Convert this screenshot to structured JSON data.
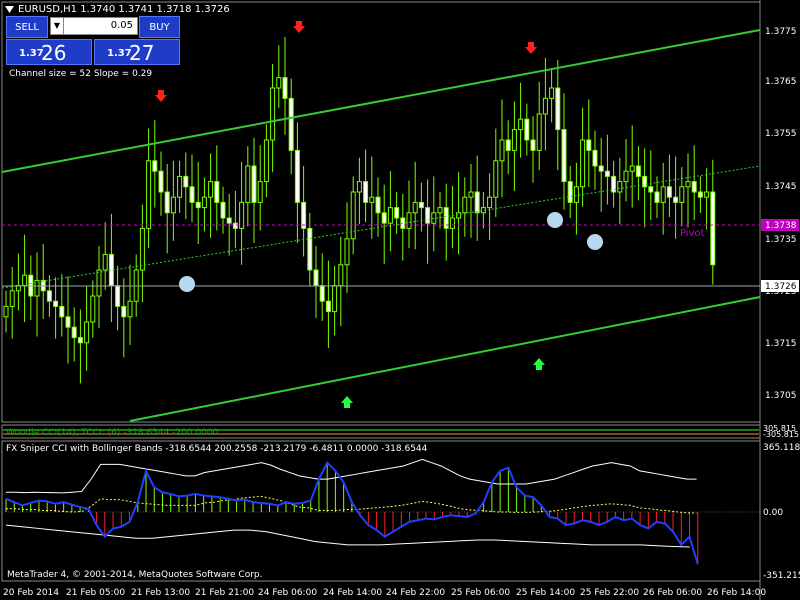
{
  "window_title": "EURUSD,H1  1.3740 1.3741 1.3718 1.3726",
  "trade_panel": {
    "sell_label": "SELL",
    "buy_label": "BUY",
    "lot_value": "0.05",
    "bid_small": "1.37",
    "bid_big": "26",
    "ask_small": "1.37",
    "ask_big": "27"
  },
  "channel_info": "Channel size = 52 Slope = 0.29",
  "pivot_label": "Pivot",
  "price_scale": [
    "1.3775",
    "1.3765",
    "1.3755",
    "1.3745",
    "1.3735",
    "1.3725",
    "1.3715",
    "1.3705"
  ],
  "price_tags": {
    "pivot": "1.3738",
    "current": "1.3726"
  },
  "indicator1": {
    "label": "Woodie CCI(14), TCCI: (6) -318.6544 -200.0000",
    "scale_top": "305.815",
    "scale_bottom": "-305.815"
  },
  "indicator2": {
    "label": "FX Sniper CCI with Bollinger Bands -318.6544 200.2558 -213.2179 -6.4811 0.0000 -318.6544",
    "scale": [
      "365.1188",
      "0.00",
      "-351.2151"
    ]
  },
  "time_axis": [
    "20 Feb 2014",
    "21 Feb 05:00",
    "21 Feb 13:00",
    "21 Feb 21:00",
    "24 Feb 06:00",
    "24 Feb 14:00",
    "24 Feb 22:00",
    "25 Feb 06:00",
    "25 Feb 14:00",
    "25 Feb 22:00",
    "26 Feb 06:00",
    "26 Feb 14:00"
  ],
  "copyright": "MetaTrader 4, © 2001-2014, MetaQuotes Software Corp.",
  "colors": {
    "background": "#000000",
    "candle": "#7fff00",
    "channel": "#32cd32",
    "pivot": "#c000c0",
    "button": "#1f3cc8",
    "cci": "#2040ff"
  },
  "chart_data": {
    "type": "candlestick",
    "symbol": "EURUSD",
    "timeframe": "H1",
    "ohlc_last": {
      "open": 1.374,
      "high": 1.3741,
      "low": 1.3718,
      "close": 1.3726
    },
    "ylim": [
      1.37,
      1.378
    ],
    "pivot": 1.3738,
    "current_price": 1.3726,
    "closes": [
      1.3718,
      1.3721,
      1.3722,
      1.3724,
      1.372,
      1.3723,
      1.3721,
      1.3719,
      1.3718,
      1.3716,
      1.3714,
      1.3712,
      1.3711,
      1.3715,
      1.372,
      1.3725,
      1.3728,
      1.3722,
      1.3718,
      1.3716,
      1.3719,
      1.3725,
      1.3733,
      1.3746,
      1.3744,
      1.374,
      1.3736,
      1.3739,
      1.3743,
      1.3741,
      1.3738,
      1.3737,
      1.3739,
      1.3742,
      1.3738,
      1.3735,
      1.3734,
      1.3733,
      1.3738,
      1.3745,
      1.3738,
      1.3742,
      1.375,
      1.376,
      1.3762,
      1.3758,
      1.3748,
      1.3738,
      1.3733,
      1.3725,
      1.3722,
      1.3719,
      1.3717,
      1.3722,
      1.3726,
      1.3731,
      1.374,
      1.3742,
      1.3738,
      1.3739,
      1.3736,
      1.3734,
      1.3737,
      1.3735,
      1.3733,
      1.3736,
      1.3738,
      1.3737,
      1.3734,
      1.3736,
      1.3737,
      1.3733,
      1.3735,
      1.3736,
      1.3739,
      1.374,
      1.3736,
      1.3737,
      1.3739,
      1.3746,
      1.375,
      1.3748,
      1.3752,
      1.3754,
      1.375,
      1.3748,
      1.3755,
      1.3758,
      1.376,
      1.3752,
      1.3742,
      1.3738,
      1.3741,
      1.375,
      1.3748,
      1.3745,
      1.3744,
      1.3743,
      1.374,
      1.3742,
      1.3744,
      1.3745,
      1.3743,
      1.3741,
      1.374,
      1.3738,
      1.3741,
      1.3739,
      1.3738,
      1.3741,
      1.3742,
      1.374,
      1.3739,
      1.374,
      1.3726
    ],
    "highs_marked": [
      1.3758,
      1.3771,
      1.3767
    ],
    "lows_marked": [
      1.3713,
      1.3716
    ],
    "channel_slope": 0.29,
    "channel_size": 52,
    "cci": {
      "values": [
        80,
        60,
        40,
        55,
        70,
        65,
        50,
        60,
        45,
        30,
        20,
        -80,
        -150,
        -100,
        -90,
        -60,
        60,
        250,
        150,
        120,
        110,
        95,
        100,
        110,
        100,
        95,
        90,
        80,
        70,
        75,
        60,
        55,
        50,
        40,
        60,
        50,
        55,
        70,
        200,
        300,
        250,
        180,
        60,
        -20,
        -80,
        -110,
        -150,
        -120,
        -90,
        -60,
        -50,
        -40,
        -45,
        -30,
        -20,
        -25,
        -30,
        -10,
        60,
        180,
        250,
        270,
        150,
        100,
        90,
        40,
        -30,
        -40,
        -80,
        -70,
        -50,
        -60,
        -80,
        -60,
        -30,
        -50,
        -40,
        -80,
        -100,
        -60,
        -70,
        -120,
        -200,
        -150,
        -318
      ],
      "upper_band": [
        120,
        120,
        118,
        120,
        119,
        118,
        116,
        120,
        125,
        200,
        290,
        290,
        290,
        280,
        270,
        260,
        250,
        240,
        230,
        220,
        220,
        240,
        250,
        260,
        270,
        280,
        290,
        300,
        285,
        260,
        240,
        220,
        210,
        200,
        200,
        210,
        220,
        230,
        240,
        250,
        260,
        270,
        280,
        300,
        320,
        300,
        280,
        250,
        220,
        200,
        190,
        180,
        170,
        170,
        170,
        170,
        180,
        190,
        200,
        220,
        240,
        260,
        280,
        290,
        300,
        290,
        280,
        250,
        240,
        230,
        220,
        210,
        200,
        200
      ],
      "lower_band": [
        -80,
        -90,
        -100,
        -110,
        -120,
        -130,
        -140,
        -150,
        -160,
        -160,
        -150,
        -140,
        -130,
        -120,
        -110,
        -110,
        -120,
        -140,
        -160,
        -180,
        -190,
        -200,
        -200,
        -200,
        -195,
        -190,
        -185,
        -180,
        -175,
        -170,
        -170,
        -175,
        -180,
        -185,
        -190,
        -195,
        -200,
        -200,
        -200,
        -200,
        -205,
        -210,
        -213
      ]
    }
  }
}
